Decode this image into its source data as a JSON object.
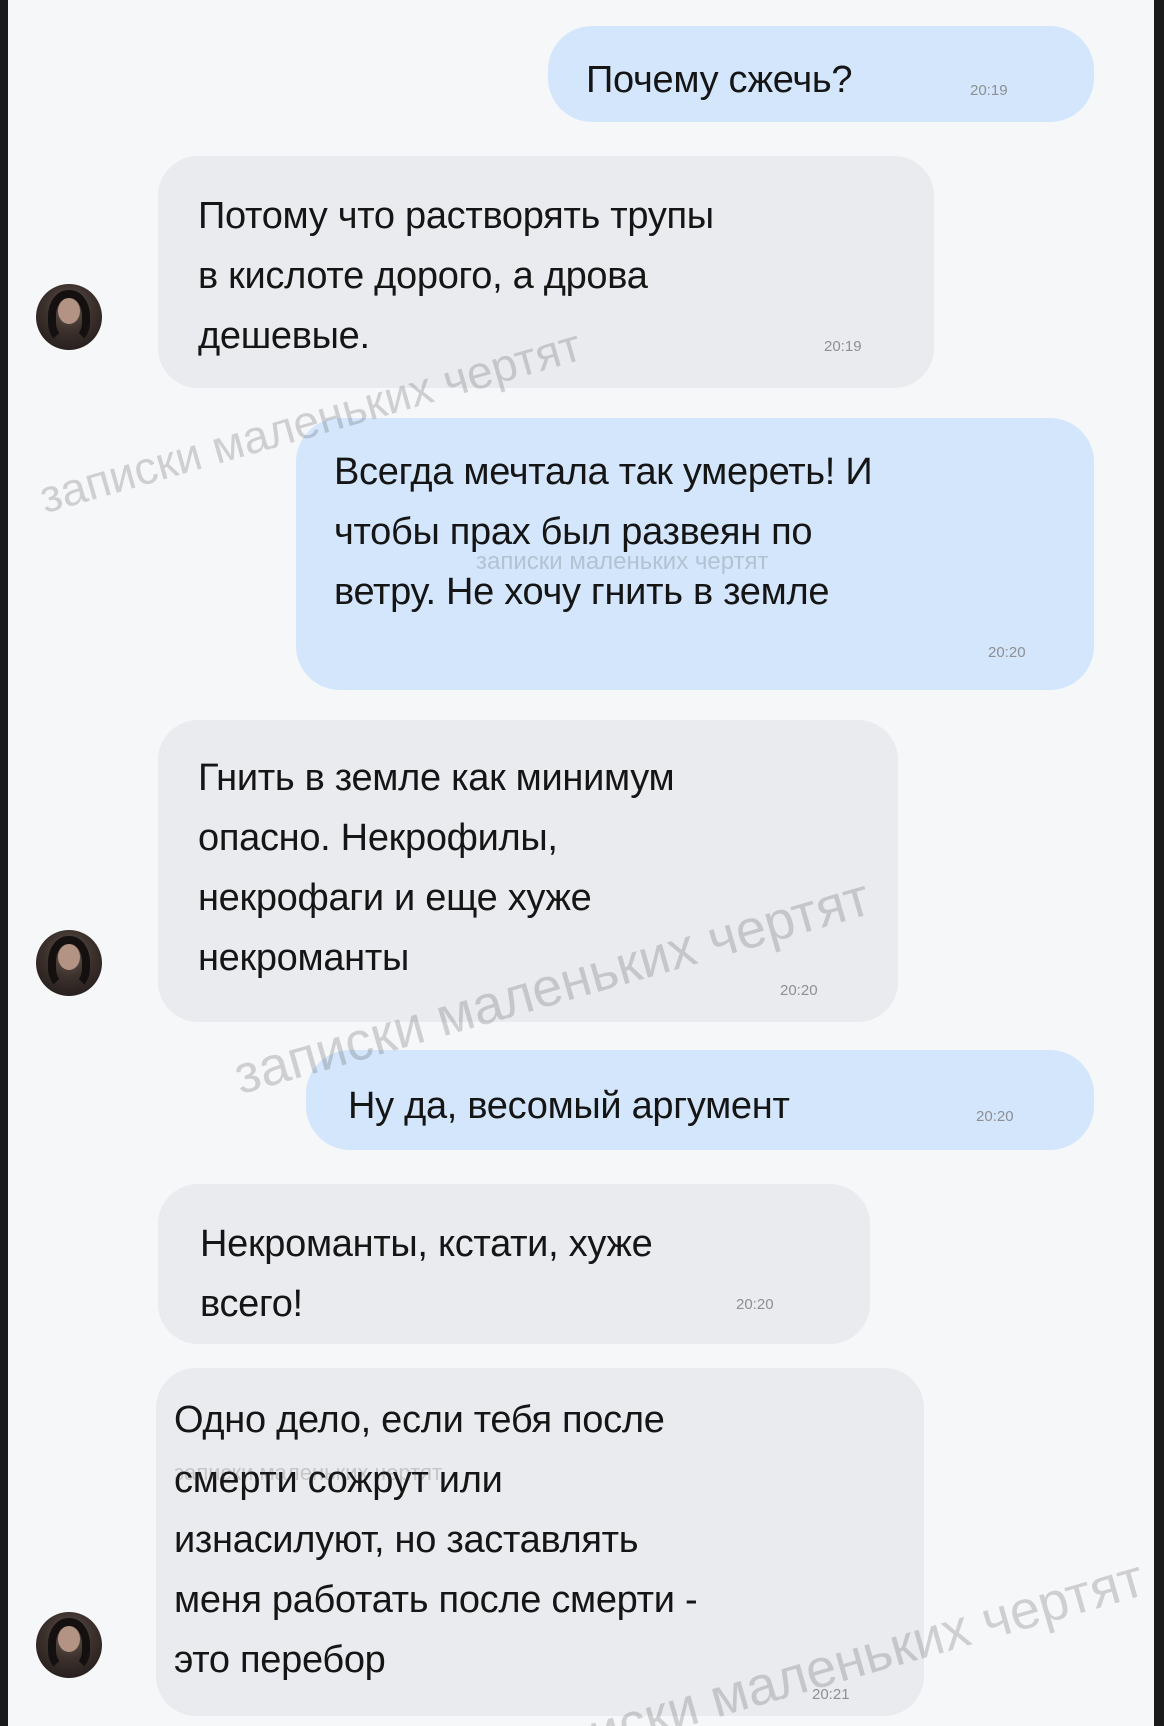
{
  "messages": [
    {
      "text": "Почему сжечь?",
      "time": "20:19"
    },
    {
      "text": "Потому что растворять трупы\nв кислоте дорого, а дрова\nдешевые.",
      "time": "20:19"
    },
    {
      "text": "Всегда мечтала так умереть! И\nчтобы прах был развеян по\nветру. Не хочу гнить в земле",
      "time": "20:20"
    },
    {
      "text": "Гнить в земле как минимум\nопасно. Некрофилы,\nнекрофаги и еще хуже\nнекроманты",
      "time": "20:20"
    },
    {
      "text": "Ну да, весомый аргумент",
      "time": "20:20"
    },
    {
      "text": "Некроманты, кстати, хуже\nвсего!",
      "time": "20:20"
    },
    {
      "text": "Одно дело, если тебя после\nсмерти сожрут или\nизнасилуют, но заставлять\nменя работать после смерти -\nэто перебор",
      "time": "20:21"
    }
  ],
  "watermark": "записки маленьких чертят"
}
